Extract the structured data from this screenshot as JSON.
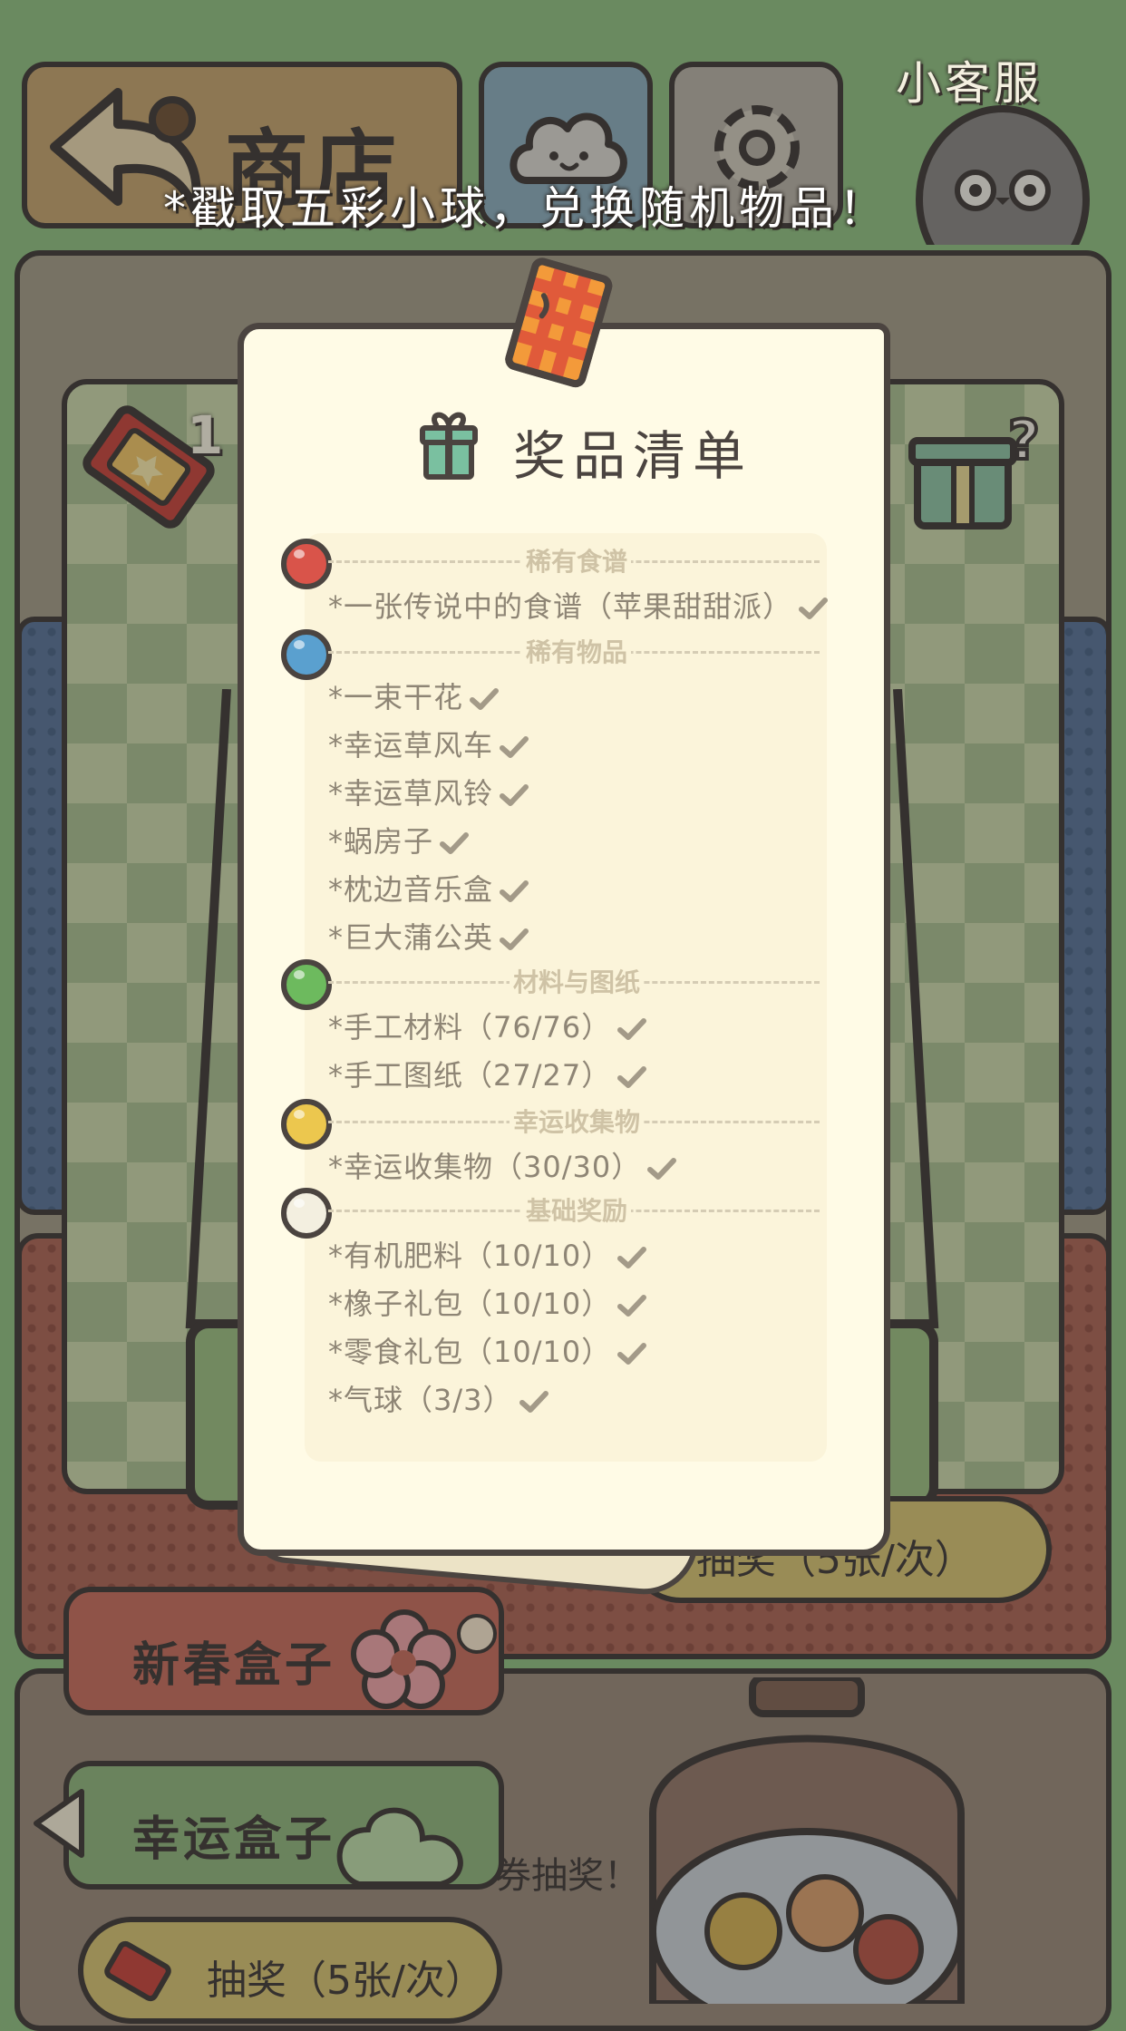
{
  "top_bar": {
    "shop_label": "商店",
    "service_label": "小客服"
  },
  "banner": {
    "text": "*戳取五彩小球，兑换随机物品！"
  },
  "background": {
    "tab_spring": "新春盒子",
    "tab_lucky": "幸运盒子",
    "draw_button_upper": "抽奖（5张/次）",
    "draw_button_lower": "抽奖（5张/次）",
    "hint_text": "券抽奖！",
    "ticket_count_partial": "1"
  },
  "modal": {
    "title": "奖品清单",
    "sections": [
      {
        "title": "稀有食谱",
        "ball_color": "#d9544a",
        "items": [
          "*一张传说中的食谱（苹果甜甜派）"
        ]
      },
      {
        "title": "稀有物品",
        "ball_color": "#5aa0cf",
        "items": [
          "*一束干花",
          "*幸运草风车",
          "*幸运草风铃",
          "*蜗房子",
          "*枕边音乐盒",
          "*巨大蒲公英"
        ]
      },
      {
        "title": "材料与图纸",
        "ball_color": "#6dba5e",
        "items": [
          "*手工材料（76/76）",
          "*手工图纸（27/27）"
        ]
      },
      {
        "title": "幸运收集物",
        "ball_color": "#ecc74e",
        "items": [
          "*幸运收集物（30/30）"
        ]
      },
      {
        "title": "基础奖励",
        "ball_color": "#f3efe0",
        "items": [
          "*有机肥料（10/10）",
          "*橡子礼包（10/10）",
          "*零食礼包（10/10）",
          "*气球（3/3）"
        ]
      }
    ]
  },
  "colors": {
    "outline": "#4b4440",
    "paper": "#fffbe6",
    "muted_text": "#8e8575",
    "section_text": "#cfc3a6",
    "background": "#6a8a60"
  },
  "icons": [
    "back-arrow-icon",
    "cloud-icon",
    "gear-icon",
    "ticket-icon",
    "gift-box-icon",
    "mystery-gift-icon",
    "check-icon",
    "flower-icon",
    "gumball-machine-icon"
  ]
}
